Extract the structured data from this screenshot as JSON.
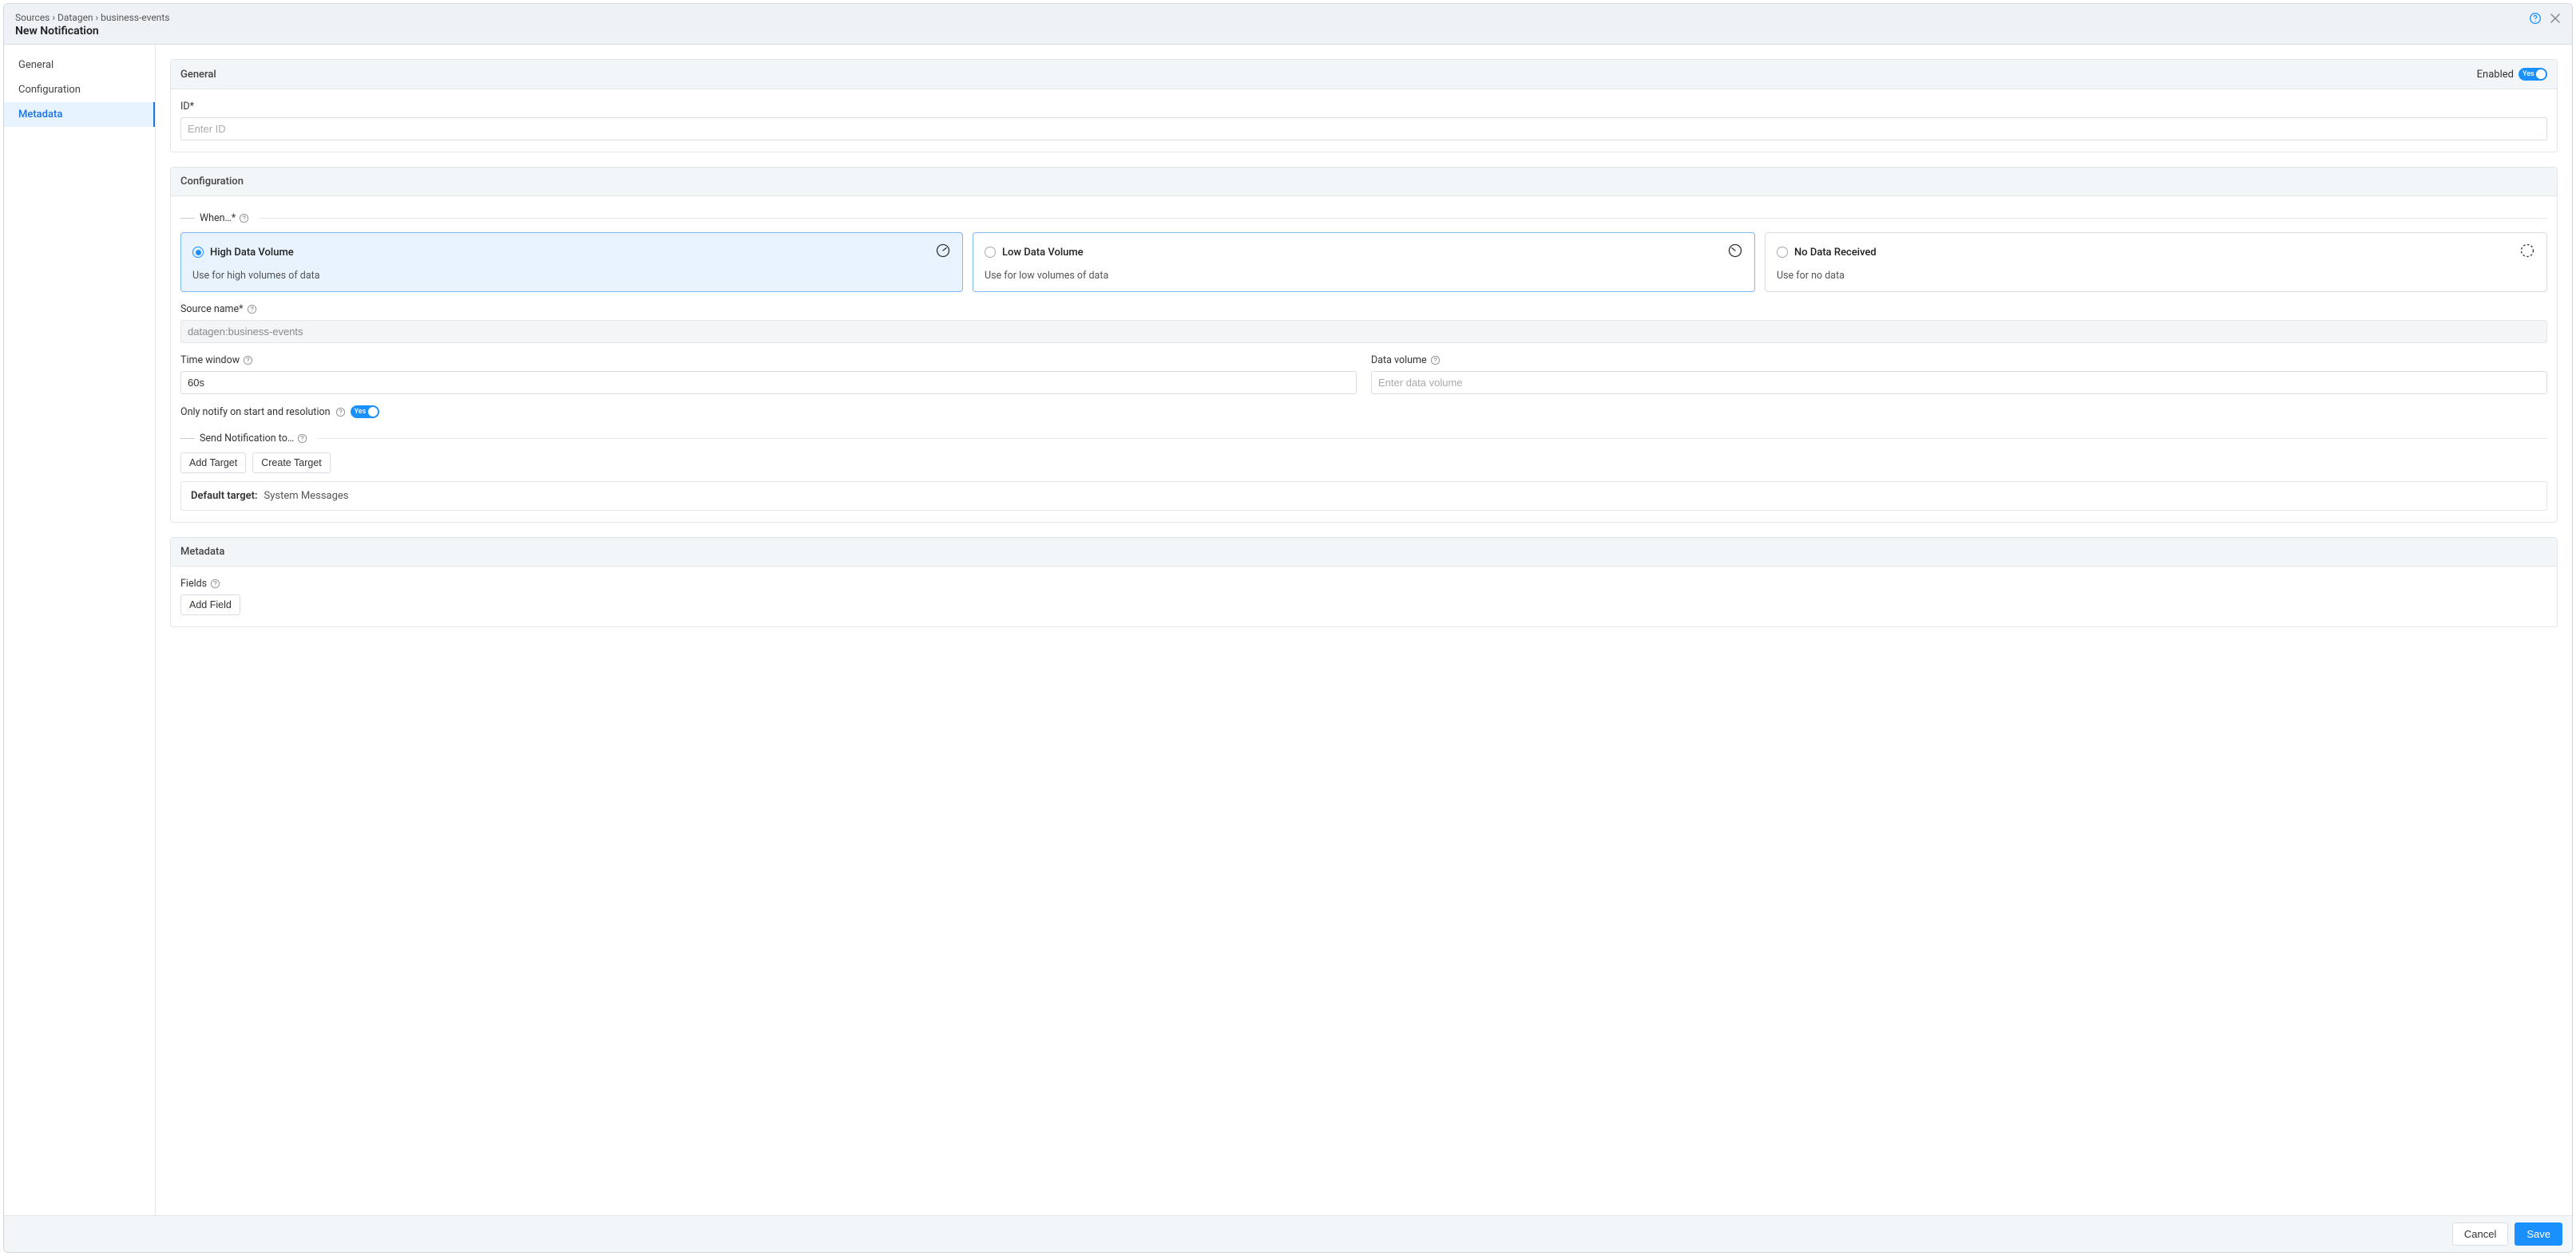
{
  "header": {
    "breadcrumbs": [
      "Sources",
      "Datagen",
      "business-events"
    ],
    "separator": "›",
    "title": "New Notification"
  },
  "sidebar": {
    "items": [
      {
        "label": "General"
      },
      {
        "label": "Configuration"
      },
      {
        "label": "Metadata"
      }
    ]
  },
  "general": {
    "heading": "General",
    "enabled_label": "Enabled",
    "toggle_text": "Yes",
    "id_label": "ID*",
    "id_placeholder": "Enter ID"
  },
  "configuration": {
    "heading": "Configuration",
    "when_label": "When…*",
    "options": [
      {
        "title": "High Data Volume",
        "desc": "Use for high volumes of data"
      },
      {
        "title": "Low Data Volume",
        "desc": "Use for low volumes of data"
      },
      {
        "title": "No Data Received",
        "desc": "Use for no data"
      }
    ],
    "source": {
      "label": "Source name*",
      "value": "datagen:business-events"
    },
    "time_window": {
      "label": "Time window",
      "value": "60s"
    },
    "data_volume": {
      "label": "Data volume",
      "placeholder": "Enter data volume"
    },
    "notify_start_res": {
      "label": "Only notify on start and resolution",
      "toggle_text": "Yes"
    },
    "send_to": {
      "label": "Send Notification to…",
      "add_target": "Add Target",
      "create_target": "Create Target"
    },
    "default_target": {
      "label": "Default target:",
      "value": "System Messages"
    }
  },
  "metadata": {
    "heading": "Metadata",
    "fields_label": "Fields",
    "add_field": "Add Field"
  },
  "footer": {
    "cancel": "Cancel",
    "save": "Save"
  }
}
